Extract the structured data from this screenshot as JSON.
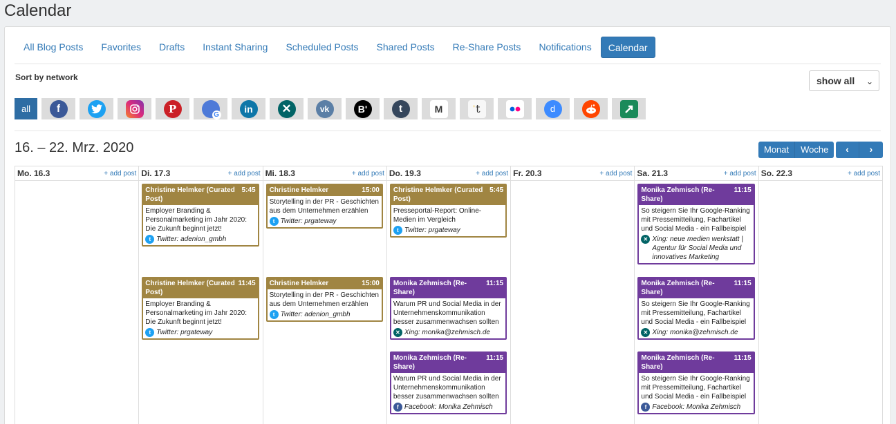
{
  "page_title": "Calendar",
  "tabs": [
    {
      "label": "All Blog Posts",
      "active": false
    },
    {
      "label": "Favorites",
      "active": false
    },
    {
      "label": "Drafts",
      "active": false
    },
    {
      "label": "Instant Sharing",
      "active": false
    },
    {
      "label": "Scheduled Posts",
      "active": false
    },
    {
      "label": "Shared Posts",
      "active": false
    },
    {
      "label": "Re-Share Posts",
      "active": false
    },
    {
      "label": "Notifications",
      "active": false
    },
    {
      "label": "Calendar",
      "active": true
    }
  ],
  "sort": {
    "label": "Sort by network",
    "select_value": "show all"
  },
  "networks": [
    {
      "label": "all",
      "icon": "all"
    },
    {
      "icon": "facebook-icon",
      "glyph": "f",
      "color": "#3b5998"
    },
    {
      "icon": "twitter-icon",
      "glyph": "t",
      "color": "#1da1f2"
    },
    {
      "icon": "instagram-icon",
      "glyph": "◎",
      "color": "#c13584"
    },
    {
      "icon": "pinterest-icon",
      "glyph": "P",
      "color": "#cb2027"
    },
    {
      "icon": "google-mybusiness-icon",
      "glyph": "G",
      "color": "#4e7ad8"
    },
    {
      "icon": "linkedin-icon",
      "glyph": "in",
      "color": "#0e76a8"
    },
    {
      "icon": "xing-icon",
      "glyph": "✕",
      "color": "#026466"
    },
    {
      "icon": "vk-icon",
      "glyph": "vk",
      "color": "#5b7fa6"
    },
    {
      "icon": "blogger-icon",
      "glyph": "B'",
      "color": "#000000"
    },
    {
      "icon": "tumblr-icon",
      "glyph": "t",
      "color": "#35465c"
    },
    {
      "icon": "medium-icon",
      "glyph": "M",
      "color": "#ffffff"
    },
    {
      "icon": "torial-icon",
      "glyph": "t",
      "color": "#f7f7f7"
    },
    {
      "icon": "flickr-icon",
      "glyph": "••",
      "color": "#ffffff"
    },
    {
      "icon": "diigo-icon",
      "glyph": "d",
      "color": "#3d8bff"
    },
    {
      "icon": "reddit-icon",
      "glyph": "☺",
      "color": "#ff4500"
    },
    {
      "icon": "buffer-share-icon",
      "glyph": "➚",
      "color": "#1b8a5a"
    }
  ],
  "calendar": {
    "range_title": "16. – 22. Mrz. 2020",
    "view_month": "Monat",
    "view_week": "Woche",
    "prev": "‹",
    "next": "›",
    "add_post_label": "+ add post",
    "days": [
      {
        "name": "Mo. 16.3"
      },
      {
        "name": "Di. 17.3"
      },
      {
        "name": "Mi. 18.3"
      },
      {
        "name": "Do. 19.3"
      },
      {
        "name": "Fr. 20.3"
      },
      {
        "name": "Sa. 21.3"
      },
      {
        "name": "So. 22.3"
      }
    ],
    "events": {
      "di_1": {
        "author": "Christine Helmker (Curated Post)",
        "time": "5:45",
        "title": "Employer Branding & Personalmarketing im Jahr 2020: Die Zukunft beginnt jetzt!",
        "account": "Twitter: adenion_gmbh"
      },
      "di_2": {
        "author": "Christine Helmker (Curated Post)",
        "time": "11:45",
        "title": "Employer Branding & Personalmarketing im Jahr 2020: Die Zukunft beginnt jetzt!",
        "account": "Twitter: prgateway"
      },
      "mi_1": {
        "author": "Christine Helmker",
        "time": "15:00",
        "title": "Storytelling in der PR - Geschichten aus dem Unternehmen erzählen",
        "account": "Twitter: prgateway"
      },
      "mi_2": {
        "author": "Christine Helmker",
        "time": "15:00",
        "title": "Storytelling in der PR - Geschichten aus dem Unternehmen erzählen",
        "account": "Twitter: adenion_gmbh"
      },
      "do_1": {
        "author": "Christine Helmker (Curated Post)",
        "time": "5:45",
        "title": "Presseportal-Report: Online-Medien im Vergleich",
        "account": "Twitter: prgateway"
      },
      "do_2": {
        "author": "Monika Zehmisch (Re-Share)",
        "time": "11:15",
        "title": "Warum PR und Social Media in der Unternehmenskommunikation besser zusammenwachsen sollten",
        "account": "Xing: monika@zehmisch.de"
      },
      "do_3": {
        "author": "Monika Zehmisch (Re-Share)",
        "time": "11:15",
        "title": "Warum PR und Social Media in der Unternehmenskommunikation besser zusammenwachsen sollten",
        "account": "Facebook: Monika Zehmisch"
      },
      "sa_1": {
        "author": "Monika Zehmisch (Re-Share)",
        "time": "11:15",
        "title": "So steigern Sie Ihr Google-Ranking mit Pressemitteilung, Fachartikel und Social Media - ein Fallbeispiel",
        "account": "Xing: neue medien werkstatt | Agentur für Social Media und innovatives Marketing"
      },
      "sa_2": {
        "author": "Monika Zehmisch (Re-Share)",
        "time": "11:15",
        "title": "So steigern Sie Ihr Google-Ranking mit Pressemitteilung, Fachartikel und Social Media - ein Fallbeispiel",
        "account": "Xing: monika@zehmisch.de"
      },
      "sa_3": {
        "author": "Monika Zehmisch (Re-Share)",
        "time": "11:15",
        "title": "So steigern Sie Ihr Google-Ranking mit Pressemitteilung, Fachartikel und Social Media - ein Fallbeispiel",
        "account": "Facebook: Monika Zehmisch"
      }
    }
  },
  "colors": {
    "accent": "#337ab7",
    "curated": "#a08542",
    "reshare": "#6f3b9c"
  }
}
